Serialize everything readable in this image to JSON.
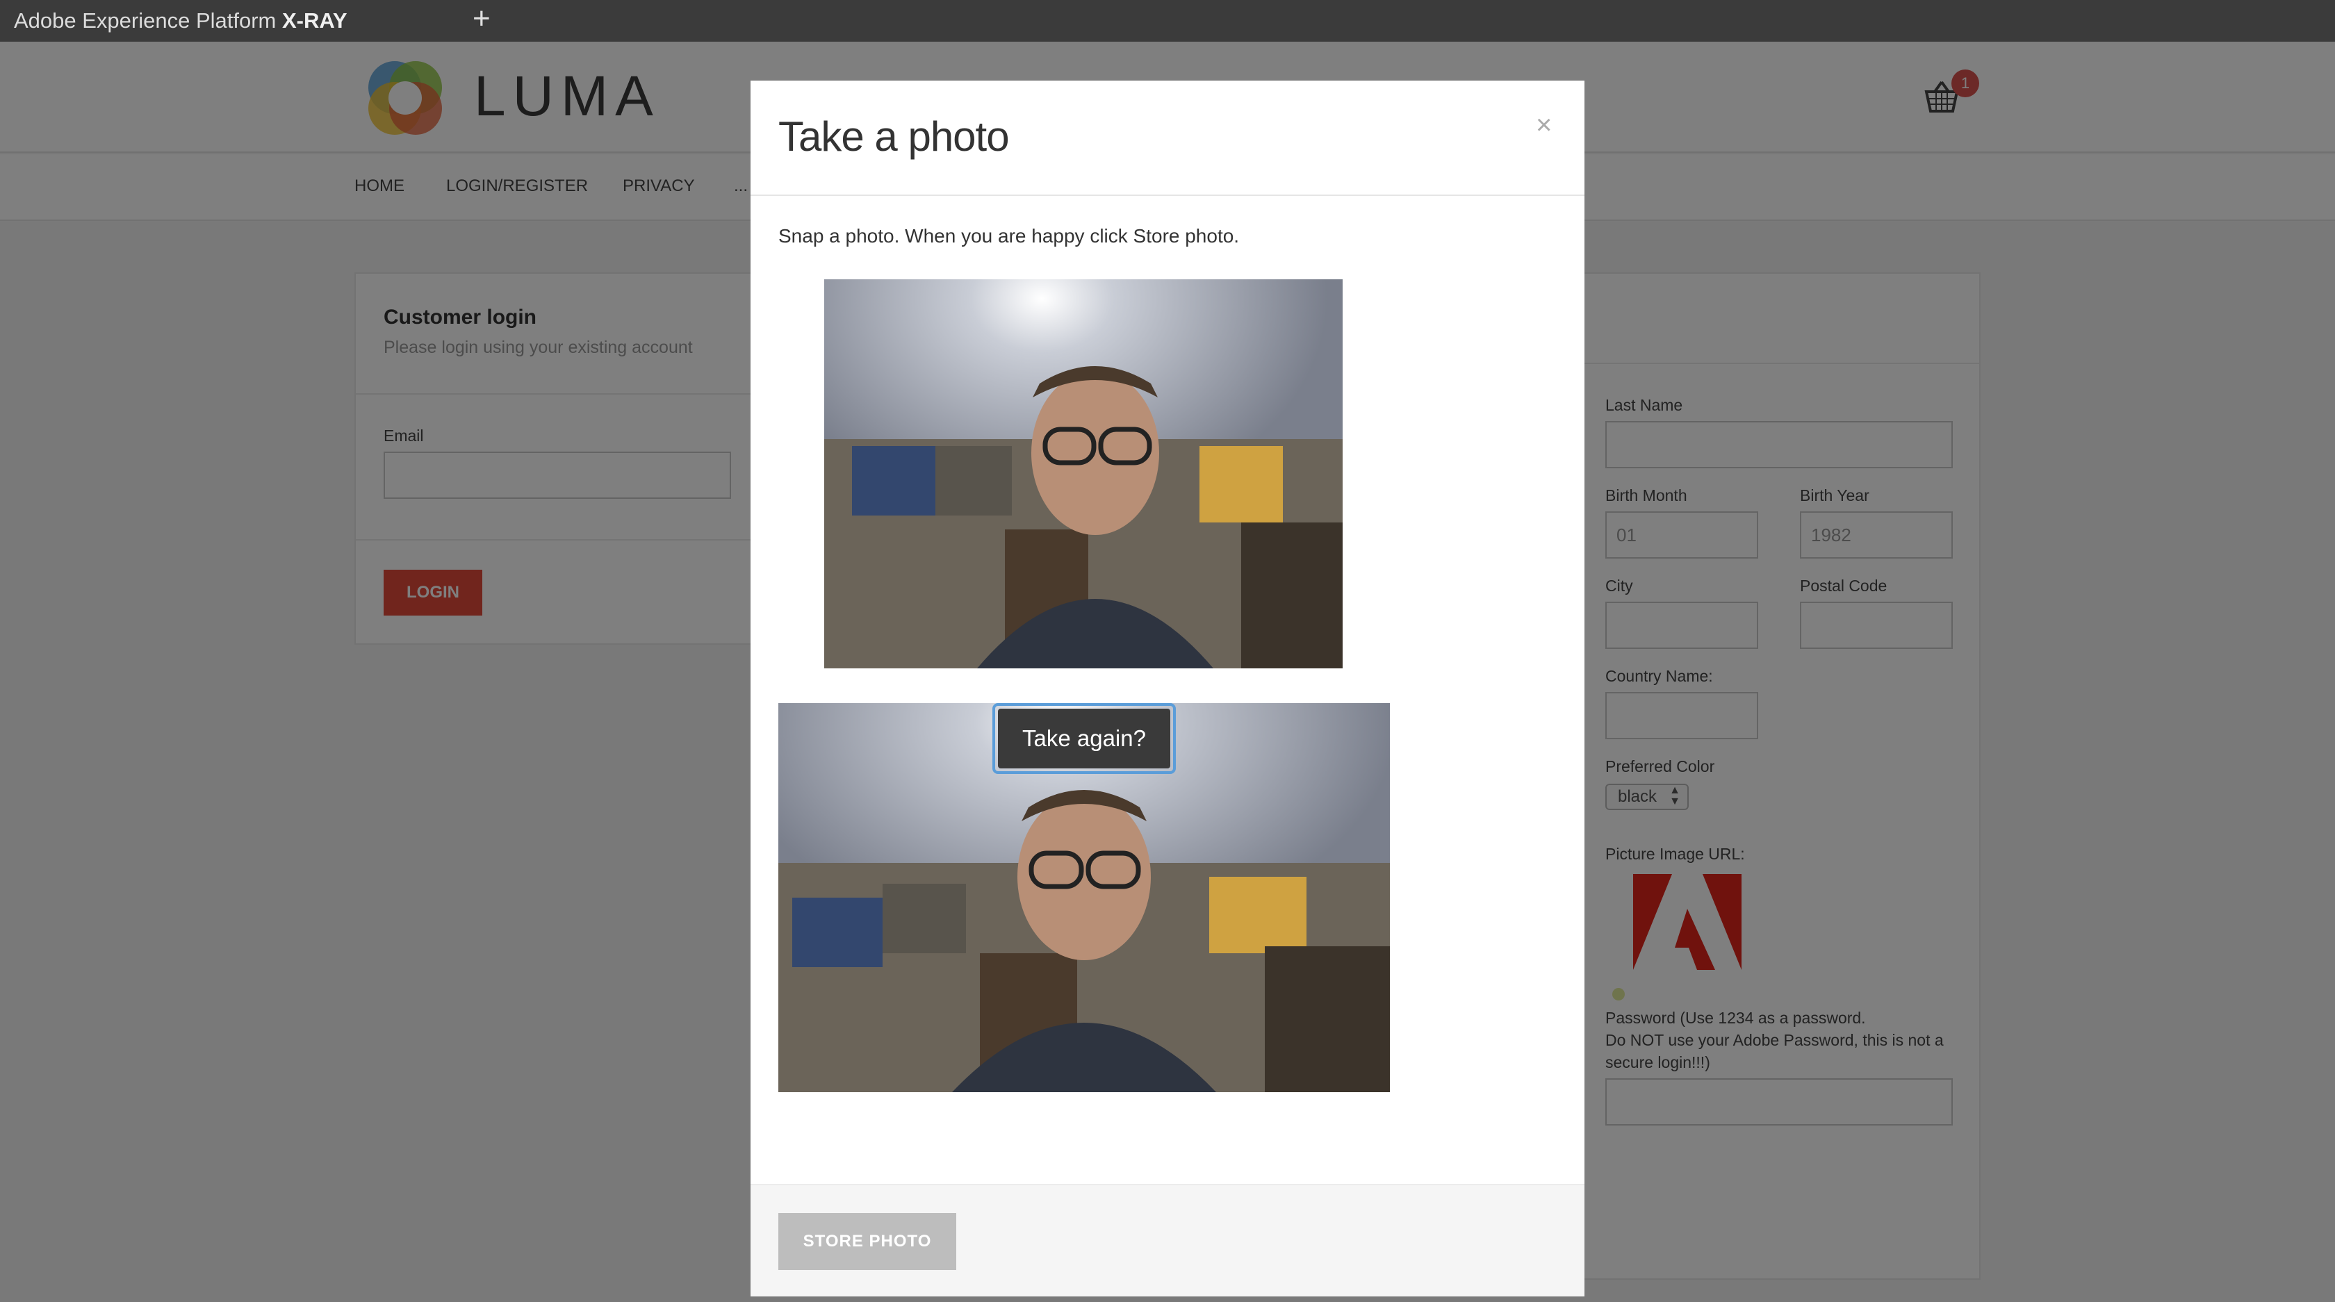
{
  "topbar": {
    "brand_prefix": "Adobe Experience Platform",
    "brand_suffix": "X-RAY",
    "new_tab_label": "+"
  },
  "header": {
    "logo_text": "LUMA",
    "cart_count": "1"
  },
  "nav": {
    "items": [
      "HOME",
      "LOGIN/REGISTER",
      "PRIVACY",
      "..."
    ]
  },
  "login_card": {
    "title": "Customer login",
    "subtitle": "Please login using your existing account",
    "email_label": "Email",
    "email_value": "",
    "login_button": "LOGIN"
  },
  "register_form": {
    "last_name_label": "Last Name",
    "birth_month_label": "Birth Month",
    "birth_month_placeholder": "01",
    "birth_year_label": "Birth Year",
    "birth_year_placeholder": "1982",
    "city_label": "City",
    "postal_code_label": "Postal Code",
    "country_label": "Country Name:",
    "color_label": "Preferred Color",
    "color_value": "black",
    "picture_label": "Picture Image URL:",
    "password_label_line1": "Password (Use 1234 as a password.",
    "password_label_line2": "Do NOT use your Adobe Password, this is not a",
    "password_label_line3": "secure login!!!)"
  },
  "modal": {
    "title": "Take a photo",
    "close_label": "×",
    "instruction": "Snap a photo. When you are happy click Store photo.",
    "take_again_label": "Take again?",
    "store_button": "STORE PHOTO"
  },
  "colors": {
    "topbar": "#3b3b3b",
    "login_button": "#e24b3b",
    "badge": "#d9534f",
    "focus_ring": "#5b9dd9",
    "store_button": "#bdbdbd"
  }
}
